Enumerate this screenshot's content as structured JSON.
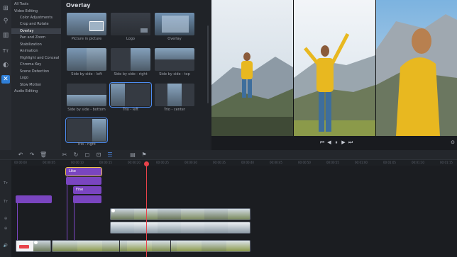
{
  "tools": {
    "items": [
      {
        "icon": "import-icon",
        "glyph": "⊞"
      },
      {
        "icon": "filter-icon",
        "glyph": "⚲"
      },
      {
        "icon": "transition-icon",
        "glyph": "▥"
      },
      {
        "icon": "text-icon",
        "glyph": "Tт"
      },
      {
        "icon": "sticker-icon",
        "glyph": "◐"
      },
      {
        "icon": "more-tools-icon",
        "glyph": "✕"
      }
    ]
  },
  "tree": {
    "items": [
      {
        "label": "All Tools",
        "level": "top"
      },
      {
        "label": "Video Editing",
        "level": "top"
      },
      {
        "label": "Color Adjustments",
        "level": "sub"
      },
      {
        "label": "Crop and Rotate",
        "level": "sub"
      },
      {
        "label": "Overlay",
        "level": "sub",
        "selected": true
      },
      {
        "label": "Pan and Zoom",
        "level": "sub"
      },
      {
        "label": "Stabilization",
        "level": "sub"
      },
      {
        "label": "Animation",
        "level": "sub"
      },
      {
        "label": "Highlight and Conceal",
        "level": "sub"
      },
      {
        "label": "Chroma Key",
        "level": "sub"
      },
      {
        "label": "Scene Detection",
        "level": "sub"
      },
      {
        "label": "Logo",
        "level": "sub"
      },
      {
        "label": "Slow Motion",
        "level": "sub"
      },
      {
        "label": "Audio Editing",
        "level": "top"
      }
    ]
  },
  "panel": {
    "title": "Overlay",
    "thumbs": [
      {
        "label": "Picture in picture"
      },
      {
        "label": "Logo"
      },
      {
        "label": "Overlay"
      },
      {
        "label": "Side by side - left"
      },
      {
        "label": "Side by side - right"
      },
      {
        "label": "Side by side - top"
      },
      {
        "label": "Side by side - bottom"
      },
      {
        "label": "Trio - left"
      },
      {
        "label": "Trio - center"
      },
      {
        "label": "Trio - right"
      }
    ]
  },
  "player": {
    "controls": [
      "⏮",
      "◀",
      "⏸",
      "▶",
      "⏭",
      "⊙"
    ]
  },
  "timeline": {
    "toolbar": [
      "↶",
      "↷",
      "🗑",
      "✂",
      "↻",
      "◻",
      "⊡",
      "☰",
      "▤",
      "⚑"
    ],
    "ruler": [
      "00:00:00",
      "00:00:05",
      "00:00:10",
      "00:00:15",
      "00:00:20",
      "00:00:25",
      "00:00:30",
      "00:00:35",
      "00:00:40",
      "00:00:45",
      "00:00:50",
      "00:00:55",
      "00:01:00",
      "00:01:05",
      "00:01:10",
      "00:01:15"
    ],
    "titles": [
      {
        "label": "Like"
      },
      {
        "label": ""
      },
      {
        "label": "Fine"
      },
      {
        "label": ""
      },
      {
        "label": ""
      }
    ],
    "track_headers": [
      "Tт",
      "Tт",
      "⊕",
      "⊕",
      "🔊"
    ],
    "colors": {
      "title_clip": "#7a45c0",
      "selected_outline": "#f0c24a",
      "playhead": "#e8424a",
      "accent": "#4d8cf0"
    }
  }
}
